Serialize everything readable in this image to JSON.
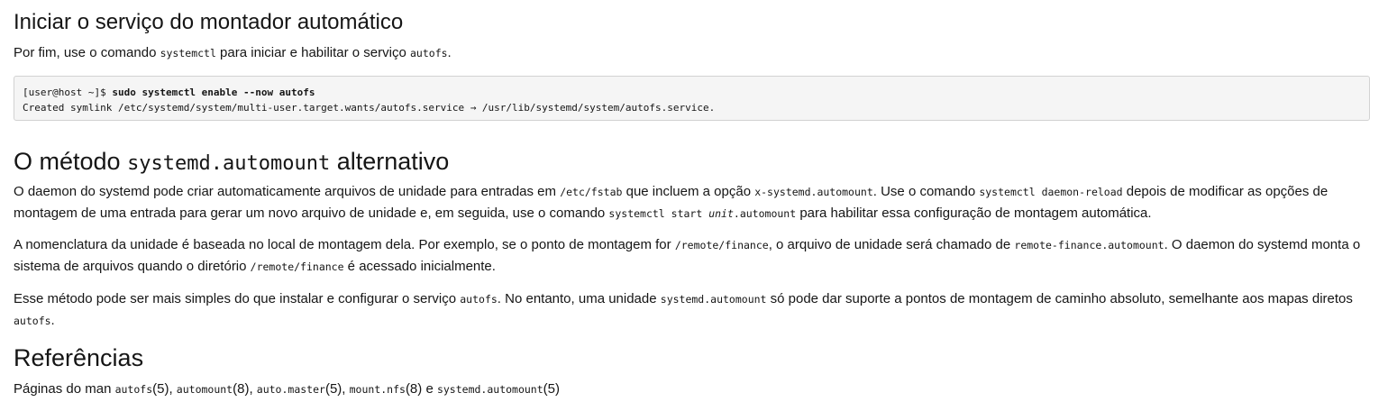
{
  "section_start": {
    "heading": "Iniciar o serviço do montador automático",
    "intro": {
      "t1": "Por fim, use o comando ",
      "c1": "systemctl",
      "t2": " para iniciar e habilitar o serviço ",
      "c2": "autofs",
      "t3": "."
    },
    "code": {
      "prompt": "[user@host ~]$ ",
      "command": "sudo systemctl enable --now autofs",
      "output": "Created symlink /etc/systemd/system/multi-user.target.wants/autofs.service → /usr/lib/systemd/system/autofs.service."
    }
  },
  "section_method": {
    "heading_pre": "O método ",
    "heading_code": "systemd.automount",
    "heading_post": " alternativo",
    "p1": {
      "t1": "O daemon do systemd pode criar automaticamente arquivos de unidade para entradas em ",
      "c1": "/etc/fstab",
      "t2": " que incluem a opção ",
      "c2": "x-systemd.automount",
      "t3": ". Use o comando ",
      "c3": "systemctl daemon-reload",
      "t4": " depois de modificar as opções de montagem de uma entrada para gerar um novo arquivo de unidade e, em seguida, use o comando ",
      "c4a": "systemctl start ",
      "c4b": "unit",
      "c4c": ".automount",
      "t5": " para habilitar essa configuração de montagem automática."
    },
    "p2": {
      "t1": "A nomenclatura da unidade é baseada no local de montagem dela. Por exemplo, se o ponto de montagem for ",
      "c1": "/remote/finance",
      "t2": ", o arquivo de unidade será chamado de ",
      "c2": "remote-finance.automount",
      "t3": ". O daemon do systemd monta o sistema de arquivos quando o diretório ",
      "c3": "/remote/finance",
      "t4": " é acessado inicialmente."
    },
    "p3": {
      "t1": "Esse método pode ser mais simples do que instalar e configurar o serviço ",
      "c1": "autofs",
      "t2": ". No entanto, uma unidade ",
      "c2": "systemd.automount",
      "t3": " só pode dar suporte a pontos de montagem de caminho absoluto, semelhante aos mapas diretos ",
      "c3": "autofs",
      "t4": "."
    }
  },
  "section_refs": {
    "heading": "Referências",
    "man": {
      "t1": "Páginas do man ",
      "c1": "autofs",
      "t2": "(5), ",
      "c2": "automount",
      "t3": "(8), ",
      "c3": "auto.master",
      "t4": "(5), ",
      "c4": "mount.nfs",
      "t5": "(8) e ",
      "c5": "systemd.automount",
      "t6": "(5)"
    }
  }
}
